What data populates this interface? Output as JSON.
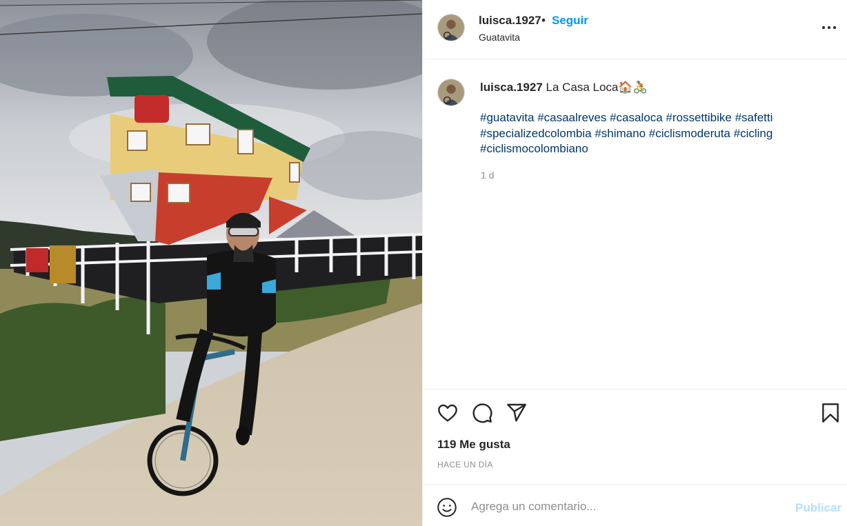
{
  "post": {
    "username": "luisca.1927",
    "separator": "•",
    "follow_label": "Seguir",
    "location": "Guatavita"
  },
  "caption": {
    "username": "luisca.1927",
    "text": "La Casa Loca",
    "emojis": "🏠🚴",
    "hashtags": [
      "#guatavita",
      "#casaalreves",
      "#casaloca",
      "#rossettibike",
      "#safetti",
      "#specializedcolombia",
      "#shimano",
      "#ciclismoderuta",
      "#cicling",
      "#ciclismocolombiano"
    ],
    "age": "1 d"
  },
  "actions": {
    "like_icon": "heart-icon",
    "comment_icon": "comment-icon",
    "share_icon": "send-icon",
    "save_icon": "bookmark-icon"
  },
  "likes": "119 Me gusta",
  "posted": "HACE UN DÍA",
  "comment": {
    "placeholder": "Agrega un comentario...",
    "publish_label": "Publicar"
  },
  "colors": {
    "link_blue": "#0095f6",
    "hashtag_blue": "#00376b",
    "publish_disabled": "#b2dffc",
    "muted": "#8e8e8e"
  }
}
